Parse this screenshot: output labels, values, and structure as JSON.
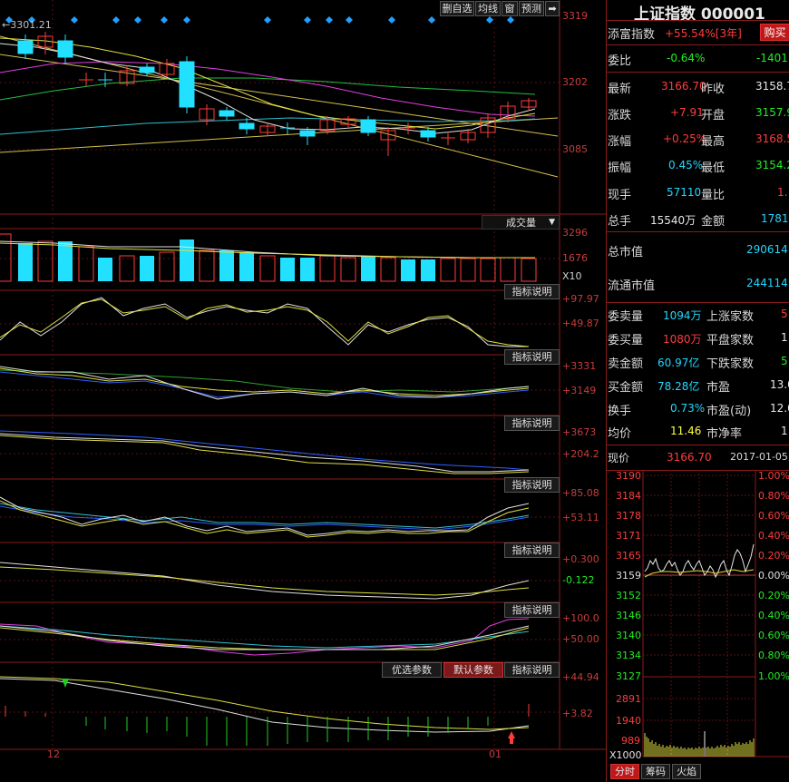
{
  "toolbar": {
    "edit_watchlist": "删自选",
    "ma_line": "均线",
    "window": "窗",
    "forecast": "预测",
    "collapse": "➡"
  },
  "main_chart": {
    "high_marker": "3301.21",
    "price_axis": [
      "3319",
      "3202",
      "3085"
    ],
    "volume_dropdown": "成交量",
    "volume_axis": [
      "3296",
      "1676",
      "X10"
    ]
  },
  "indicators": {
    "explain_label": "指标说明",
    "panels": [
      {
        "axis": [
          "+97.97",
          "+49.87"
        ]
      },
      {
        "axis": [
          "+3331",
          "+3149"
        ]
      },
      {
        "axis": [
          "+3673",
          "+204.2"
        ]
      },
      {
        "axis": [
          "+85.08",
          "+53.11"
        ]
      },
      {
        "axis": [
          "+0.300",
          "-0.122"
        ]
      },
      {
        "axis": [
          "+100.0",
          "+50.00"
        ]
      },
      {
        "axis": [
          "+44.94",
          "+3.82"
        ]
      }
    ],
    "optimize_params": "优选参数",
    "default_params": "默认参数"
  },
  "date_axis": {
    "labels": [
      "12",
      "01"
    ]
  },
  "quote": {
    "title": "上证指数 000001",
    "add_wealth_label": "添富指数",
    "add_wealth_value": "+55.54%[3年]",
    "buy_button": "购买",
    "ratio_label": "委比",
    "ratio_value": "-0.64%",
    "ratio_diff": "-1401",
    "rows": [
      {
        "l1": "最新",
        "v1": "3166.70",
        "l2": "昨收",
        "v2": "3158.7"
      },
      {
        "l1": "涨跌",
        "v1": "+7.91",
        "l2": "开盘",
        "v2": "3157.9"
      },
      {
        "l1": "涨幅",
        "v1": "+0.25%",
        "l2": "最高",
        "v2": "3168.5"
      },
      {
        "l1": "振幅",
        "v1": "0.45%",
        "l2": "最低",
        "v2": "3154.2"
      },
      {
        "l1": "现手",
        "v1": "57110",
        "l2": "量比",
        "v2": "1."
      },
      {
        "l1": "总手",
        "v1": "15540万",
        "l2": "金额",
        "v2": "1781"
      }
    ],
    "total_cap_label": "总市值",
    "total_cap_value": "290614",
    "float_cap_label": "流通市值",
    "float_cap_value": "244114",
    "rows2": [
      {
        "l1": "委卖量",
        "v1": "1094万",
        "l2": "上涨家数",
        "v2": "5"
      },
      {
        "l1": "委买量",
        "v1": "1080万",
        "l2": "平盘家数",
        "v2": "1"
      },
      {
        "l1": "卖金额",
        "v1": "60.97亿",
        "l2": "下跌家数",
        "v2": "5"
      },
      {
        "l1": "买金额",
        "v1": "78.28亿",
        "l2": "市盈",
        "v2": "13.0"
      },
      {
        "l1": "换手",
        "v1": "0.73%",
        "l2": "市盈(动)",
        "v2": "12.0"
      },
      {
        "l1": "均价",
        "v1": "11.46",
        "l2": "市净率",
        "v2": "1"
      }
    ],
    "current_label": "现价",
    "current_value": "3166.70",
    "date": "2017-01-05,"
  },
  "intraday": {
    "price_axis": [
      "3190",
      "3184",
      "3178",
      "3171",
      "3165",
      "3159",
      "3152",
      "3146",
      "3140",
      "3134",
      "3127"
    ],
    "pct_axis": [
      "1.00%",
      "0.80%",
      "0.60%",
      "0.40%",
      "0.20%",
      "0.00%",
      "0.20%",
      "0.40%",
      "0.60%",
      "0.80%",
      "1.00%"
    ],
    "vol_axis": [
      "2891",
      "1940",
      "989",
      "X1000"
    ],
    "tabs": [
      "分时",
      "筹码",
      "火焰"
    ]
  }
}
